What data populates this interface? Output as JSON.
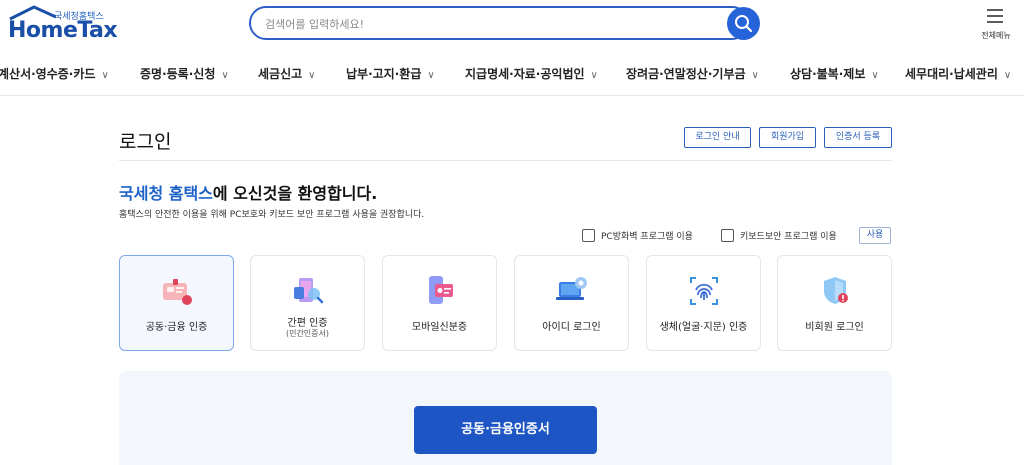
{
  "header": {
    "logo_sub": "국세청홈택스",
    "logo_main": "HomeTax",
    "search_placeholder": "검색어를 입력하세요!",
    "menu_label": "전체메뉴"
  },
  "nav": {
    "items": [
      {
        "label": "계산서·영수증·카드"
      },
      {
        "label": "증명·등록·신청"
      },
      {
        "label": "세금신고"
      },
      {
        "label": "납부·고지·환급"
      },
      {
        "label": "지급명세·자료·공익법인"
      },
      {
        "label": "장려금·연말정산·기부금"
      },
      {
        "label": "상담·불복·제보"
      },
      {
        "label": "세무대리·납세관리"
      }
    ]
  },
  "main": {
    "title": "로그인",
    "links": {
      "guide": "로그인 안내",
      "signup": "회원가입",
      "cert_register": "인증서 등록"
    },
    "welcome_brand": "국세청 홈택스",
    "welcome_rest": "에 오신것을 환영합니다.",
    "description": "홈택스의 안전한 이용을 위해 PC보호와 키보드 보안 프로그램 사용을 권장합니다.",
    "options": {
      "pc_firewall": "PC방화벽 프로그램 이용",
      "keyboard_security": "키보드보안 프로그램 이용",
      "use_button": "사용"
    },
    "login_methods": [
      {
        "label": "공동·금융 인증",
        "sub": ""
      },
      {
        "label": "간편 인증",
        "sub": "(민간인증서)"
      },
      {
        "label": "모바일신분증",
        "sub": ""
      },
      {
        "label": "아이디 로그인",
        "sub": ""
      },
      {
        "label": "생체(얼굴·지문) 인증",
        "sub": ""
      },
      {
        "label": "비회원 로그인",
        "sub": ""
      }
    ],
    "selected_method": "공동·금융 인증",
    "submit_label": "공동·금융인증서"
  },
  "colors": {
    "brand_blue": "#1d55c4",
    "accent_red": "#e0445a",
    "link_blue": "#2b5fb8"
  }
}
